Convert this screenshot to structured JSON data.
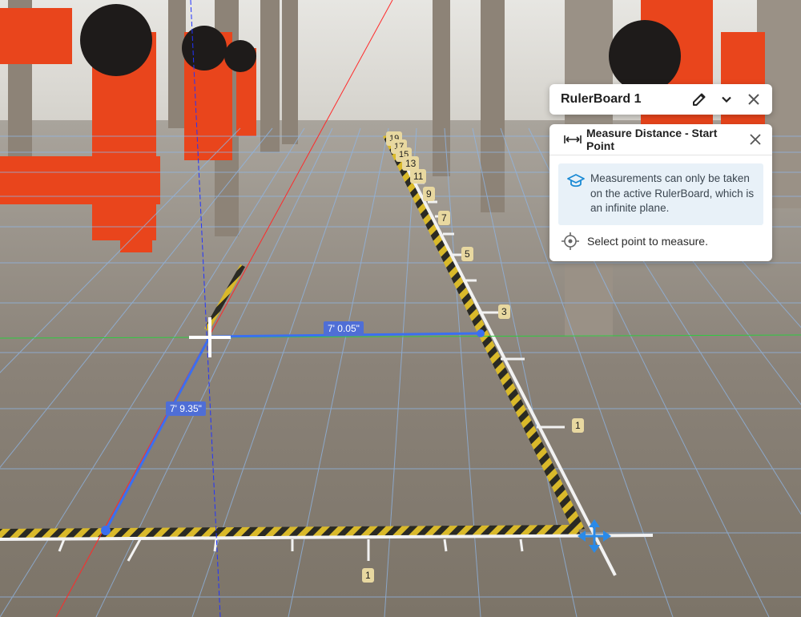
{
  "rulerboard": {
    "title": "RulerBoard 1",
    "edit_icon": "pencil-icon",
    "expand_icon": "chevron-down-icon",
    "close_icon": "close-icon"
  },
  "measure_panel": {
    "title": "Measure Distance - Start Point",
    "mode_icon": "measure-distance-icon",
    "close_icon": "close-icon",
    "info_icon": "education-cap-icon",
    "info_text": "Measurements can only be taken on the active RulerBoard, which is an infinite plane.",
    "hint_icon": "crosshair-target-icon",
    "hint_text": "Select point to measure."
  },
  "measurements": {
    "horizontal": "7' 0.05\"",
    "diagonal": "7' 9.35\""
  },
  "ruler_ticks": {
    "side": [
      "19",
      "17",
      "15",
      "13",
      "11",
      "9",
      "7",
      "5",
      "3",
      "1"
    ],
    "bottom": [
      "1"
    ]
  },
  "colors": {
    "measure_line": "#3b6ff0",
    "label_bg": "#4f6ed6",
    "tick_label_bg": "#e8d8a0",
    "pipe": "#e9451c",
    "grid": "#8fb6e6"
  }
}
